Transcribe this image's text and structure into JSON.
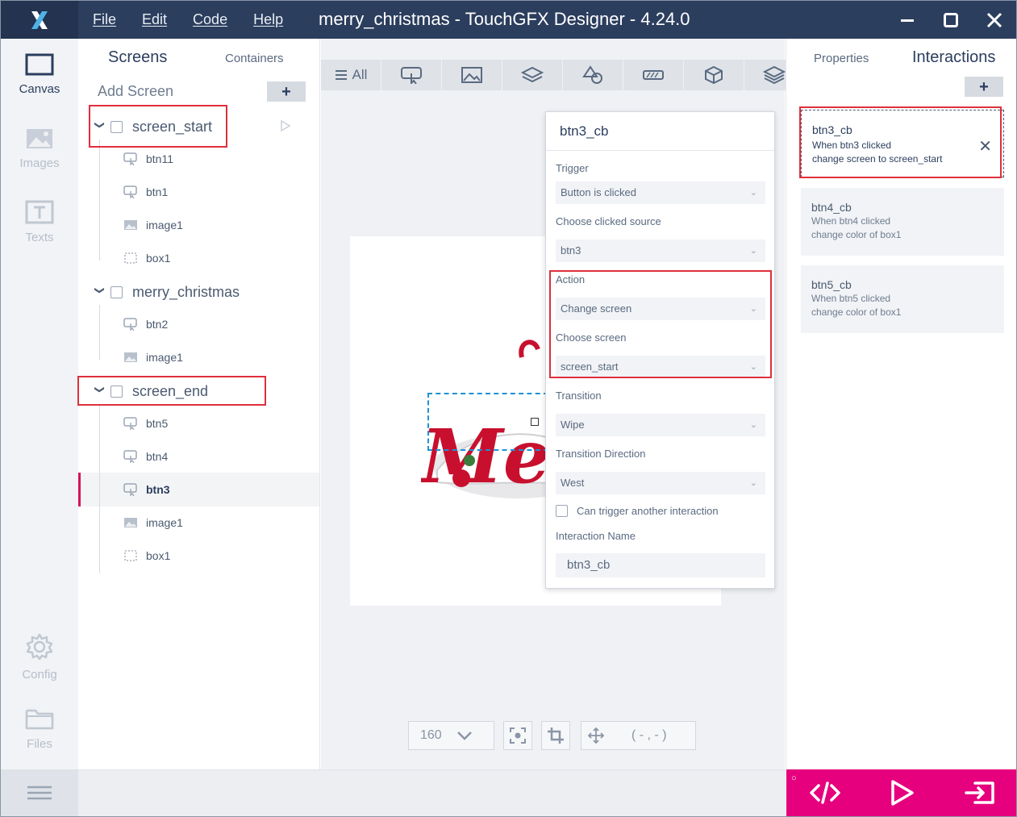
{
  "window": {
    "title": "merry_christmas - TouchGFX Designer - 4.24.0",
    "menu": [
      "File",
      "Edit",
      "Code",
      "Help"
    ]
  },
  "rail": {
    "canvas": "Canvas",
    "images": "Images",
    "texts": "Texts",
    "config": "Config",
    "files": "Files"
  },
  "screens_panel": {
    "tab_screens": "Screens",
    "tab_containers": "Containers",
    "add_screen": "Add Screen",
    "add_symbol": "+",
    "screens": [
      {
        "name": "screen_start",
        "children": [
          "btn11",
          "btn1",
          "image1",
          "box1"
        ]
      },
      {
        "name": "merry_christmas",
        "children": [
          "btn2",
          "image1"
        ]
      },
      {
        "name": "screen_end",
        "children": [
          "btn5",
          "btn4",
          "btn3",
          "image1",
          "box1"
        ]
      }
    ],
    "selected": "btn3"
  },
  "canvas": {
    "toolbar_all": "All",
    "zoom": "160",
    "coords": "( - , - )",
    "artwork_text": "Merry Christmas"
  },
  "editor": {
    "name": "btn3_cb",
    "trigger_label": "Trigger",
    "trigger_value": "Button is clicked",
    "source_label": "Choose clicked source",
    "source_value": "btn3",
    "action_label": "Action",
    "action_value": "Change screen",
    "screen_label": "Choose screen",
    "screen_value": "screen_start",
    "transition_label": "Transition",
    "transition_value": "Wipe",
    "direction_label": "Transition Direction",
    "direction_value": "West",
    "can_trigger_label": "Can trigger another interaction",
    "can_trigger_checked": false,
    "interaction_name_label": "Interaction Name",
    "interaction_name_value": "btn3_cb"
  },
  "right_panel": {
    "tab_properties": "Properties",
    "tab_interactions": "Interactions",
    "add_symbol": "+",
    "interactions": [
      {
        "name": "btn3_cb",
        "line1": "When btn3 clicked",
        "line2": "change screen to screen_start",
        "active": true
      },
      {
        "name": "btn4_cb",
        "line1": "When btn4 clicked",
        "line2": "change color of box1",
        "active": false
      },
      {
        "name": "btn5_cb",
        "line1": "When btn5 clicked",
        "line2": "change color of box1",
        "active": false
      }
    ]
  },
  "colors": {
    "titlebar": "#2c3e5e",
    "accent_pink": "#e6007e",
    "highlight_red": "#e02f3c",
    "selection_blue": "#1e90d6"
  }
}
